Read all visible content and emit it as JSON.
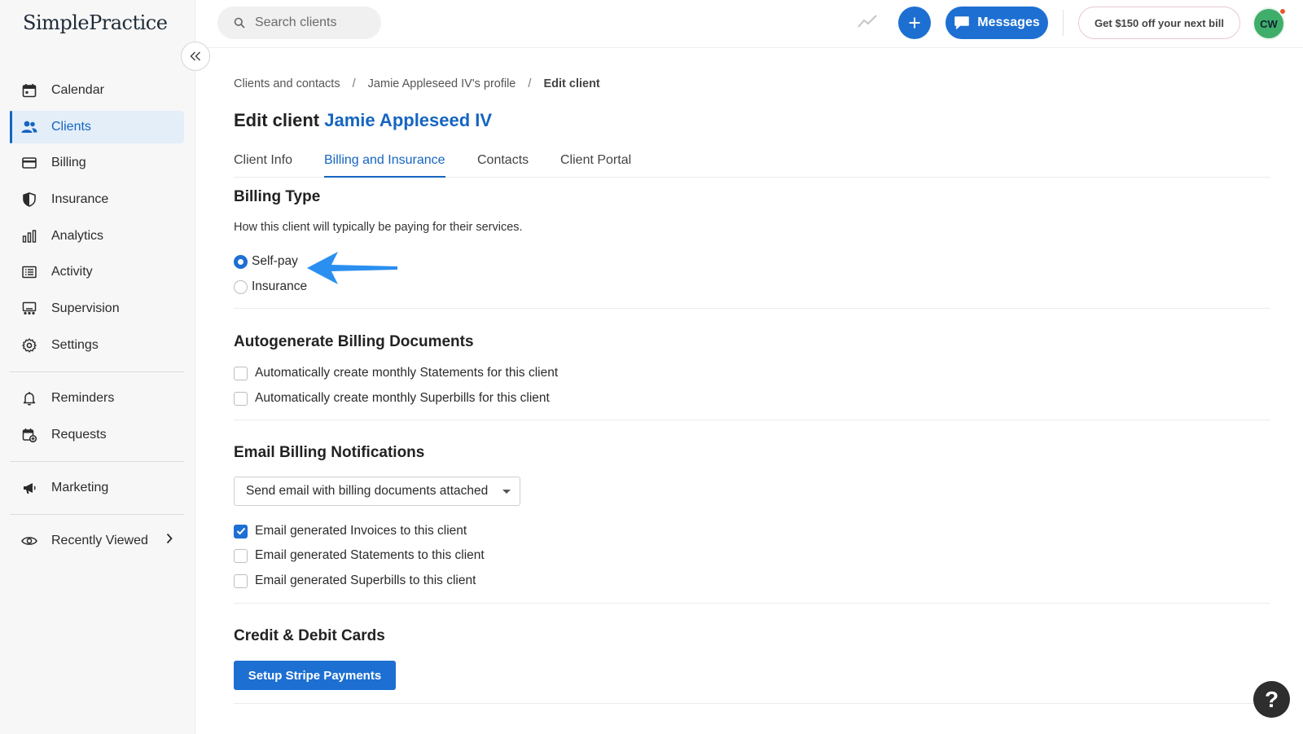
{
  "brand": {
    "logo_text": "SimplePractice"
  },
  "sidebar": {
    "items": [
      {
        "label": "Calendar",
        "icon": "calendar-icon"
      },
      {
        "label": "Clients",
        "icon": "users-icon",
        "active": true
      },
      {
        "label": "Billing",
        "icon": "credit-card-icon"
      },
      {
        "label": "Insurance",
        "icon": "shield-icon"
      },
      {
        "label": "Analytics",
        "icon": "bar-chart-icon"
      },
      {
        "label": "Activity",
        "icon": "list-icon"
      },
      {
        "label": "Supervision",
        "icon": "supervision-icon"
      },
      {
        "label": "Settings",
        "icon": "gear-icon"
      }
    ],
    "secondary": [
      {
        "label": "Reminders",
        "icon": "bell-icon"
      },
      {
        "label": "Requests",
        "icon": "calendar-plus-icon"
      }
    ],
    "tertiary": [
      {
        "label": "Marketing",
        "icon": "megaphone-icon"
      }
    ],
    "recently_viewed": {
      "label": "Recently Viewed",
      "icon": "eye-icon"
    }
  },
  "topbar": {
    "search_placeholder": "Search clients",
    "messages_label": "Messages",
    "promo_label": "Get $150 off your next bill",
    "avatar_initials": "CW"
  },
  "breadcrumb": {
    "items": [
      "Clients and contacts",
      "Jamie Appleseed IV's profile",
      "Edit client"
    ],
    "separator": "/"
  },
  "page": {
    "title_prefix": "Edit client",
    "client_name": "Jamie Appleseed IV"
  },
  "tabs": [
    {
      "label": "Client Info"
    },
    {
      "label": "Billing and Insurance",
      "active": true
    },
    {
      "label": "Contacts"
    },
    {
      "label": "Client Portal"
    }
  ],
  "billing_type": {
    "title": "Billing Type",
    "description": "How this client will typically be paying for their services.",
    "options": [
      {
        "label": "Self-pay",
        "selected": true
      },
      {
        "label": "Insurance",
        "selected": false
      }
    ]
  },
  "autogenerate": {
    "title": "Autogenerate Billing Documents",
    "options": [
      {
        "label": "Automatically create monthly Statements for this client",
        "checked": false
      },
      {
        "label": "Automatically create monthly Superbills for this client",
        "checked": false
      }
    ]
  },
  "email_notifications": {
    "title": "Email Billing Notifications",
    "select_value": "Send email with billing documents attached",
    "options": [
      {
        "label": "Email generated Invoices to this client",
        "checked": true
      },
      {
        "label": "Email generated Statements to this client",
        "checked": false
      },
      {
        "label": "Email generated Superbills to this client",
        "checked": false
      }
    ]
  },
  "cards": {
    "title": "Credit & Debit Cards",
    "button_label": "Setup Stripe Payments"
  },
  "help": {
    "label": "?"
  },
  "colors": {
    "primary": "#1d6fd2",
    "active_text": "#1565c0",
    "active_bg": "#e3eef9",
    "avatar": "#3fae6a",
    "annotation_arrow": "#2b8ff0"
  }
}
